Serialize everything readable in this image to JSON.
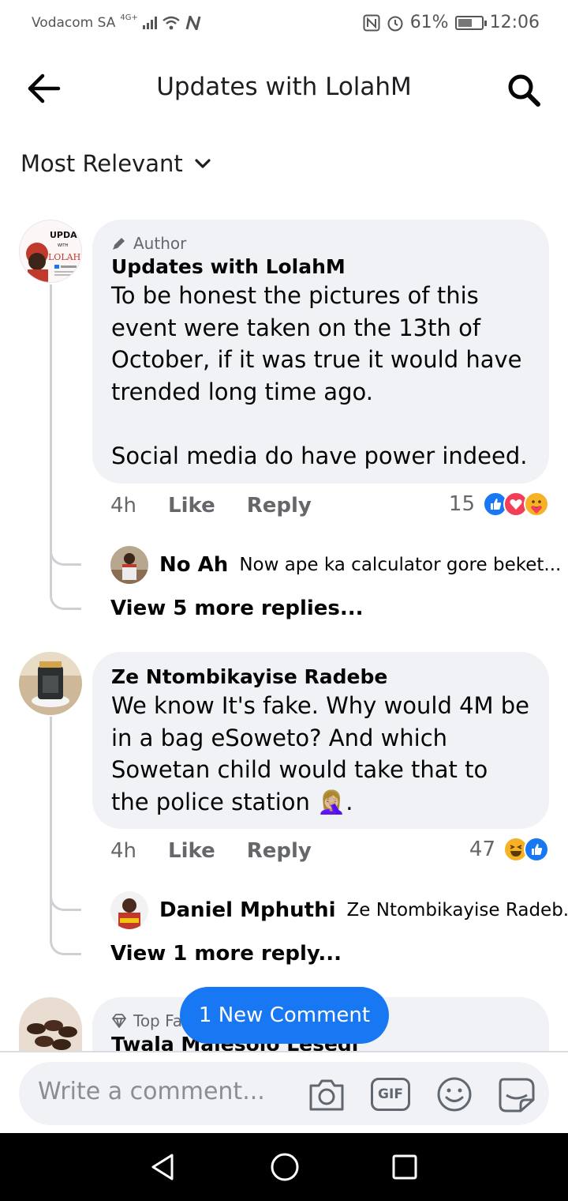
{
  "status_bar": {
    "carrier": "Vodacom SA",
    "network": "4G+",
    "battery_percent": "61%",
    "battery_level": 0.61,
    "time": "12:06"
  },
  "header": {
    "title": "Updates with LolahM"
  },
  "filter": {
    "label": "Most Relevant"
  },
  "comments": [
    {
      "tag": "Author",
      "tag_icon": "pencil-icon",
      "name": "Updates with LolahM",
      "text": "To be honest the pictures of this event were taken on the 13th of October, if it was true it would have trended long time ago.\n\nSocial media do have power indeed.",
      "time": "4h",
      "like": "Like",
      "reply": "Reply",
      "reaction_count": "15",
      "reactions": [
        "like-icon",
        "love-icon",
        "care-icon"
      ],
      "avatar_label_1": "UPDATE",
      "avatar_label_2": "WITH",
      "avatar_label_3": "LOLAH M",
      "reply_preview": {
        "name": "No Ah",
        "text": "Now ape ka calculator gore beket..."
      },
      "view_more": "View 5 more replies..."
    },
    {
      "name": "Ze Ntombikayise Radebe",
      "text": "We know It's fake. Why would 4M be in a bag eSoweto? And which Sowetan child would take that to the police station 🤦🏼‍♀️.",
      "time": "4h",
      "like": "Like",
      "reply": "Reply",
      "reaction_count": "47",
      "reactions": [
        "haha-icon",
        "like-icon"
      ],
      "reply_preview": {
        "name": "Daniel Mphuthi",
        "text": "Ze Ntombikayise Radeb..."
      },
      "view_more": "View 1 more reply..."
    },
    {
      "tag": "Top Fa",
      "tag_icon": "diamond-icon",
      "name": "Twala Malesolo Lesedi"
    }
  ],
  "new_comment_pill": "1 New Comment",
  "composer": {
    "placeholder": "Write a comment...",
    "gif_label": "GIF"
  }
}
